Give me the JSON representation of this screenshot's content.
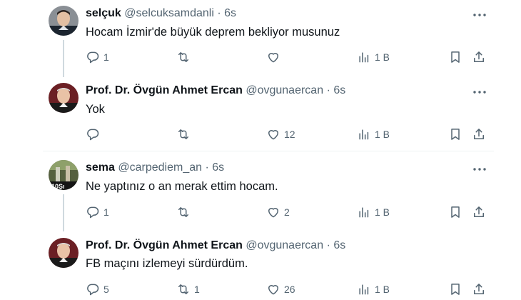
{
  "tweets": [
    {
      "name": "selçuk",
      "handle": "@selcuksamdanli",
      "separator": "·",
      "time": "6s",
      "text": "Hocam İzmir'de büyük deprem bekliyor musunuz",
      "reply_count": "1",
      "retweet_count": "",
      "like_count": "",
      "views": "1 B"
    },
    {
      "name": "Prof. Dr. Övgün Ahmet Ercan",
      "handle": "@ovgunaercan",
      "separator": "·",
      "time": "6s",
      "text": "Yok",
      "reply_count": "",
      "retweet_count": "",
      "like_count": "12",
      "views": "1 B"
    },
    {
      "name": "sema",
      "handle": "@carpediem_an",
      "separator": "·",
      "time": "6s",
      "text": "Ne yaptınız o an merak ettim hocam.",
      "reply_count": "1",
      "retweet_count": "",
      "like_count": "2",
      "views": "1 B"
    },
    {
      "name": "Prof. Dr. Övgün Ahmet Ercan",
      "handle": "@ovgunaercan",
      "separator": "·",
      "time": "6s",
      "text": "FB maçını izlemeyi sürdürdüm.",
      "reply_count": "5",
      "retweet_count": "1",
      "like_count": "26",
      "views": "1 B"
    }
  ],
  "colors": {
    "text": "#0f1419",
    "secondary": "#536471",
    "thread_line": "#cfd9de",
    "divider": "#eff3f4"
  },
  "icons": [
    "reply-icon",
    "retweet-icon",
    "like-icon",
    "views-icon",
    "bookmark-icon",
    "share-icon",
    "more-icon"
  ]
}
